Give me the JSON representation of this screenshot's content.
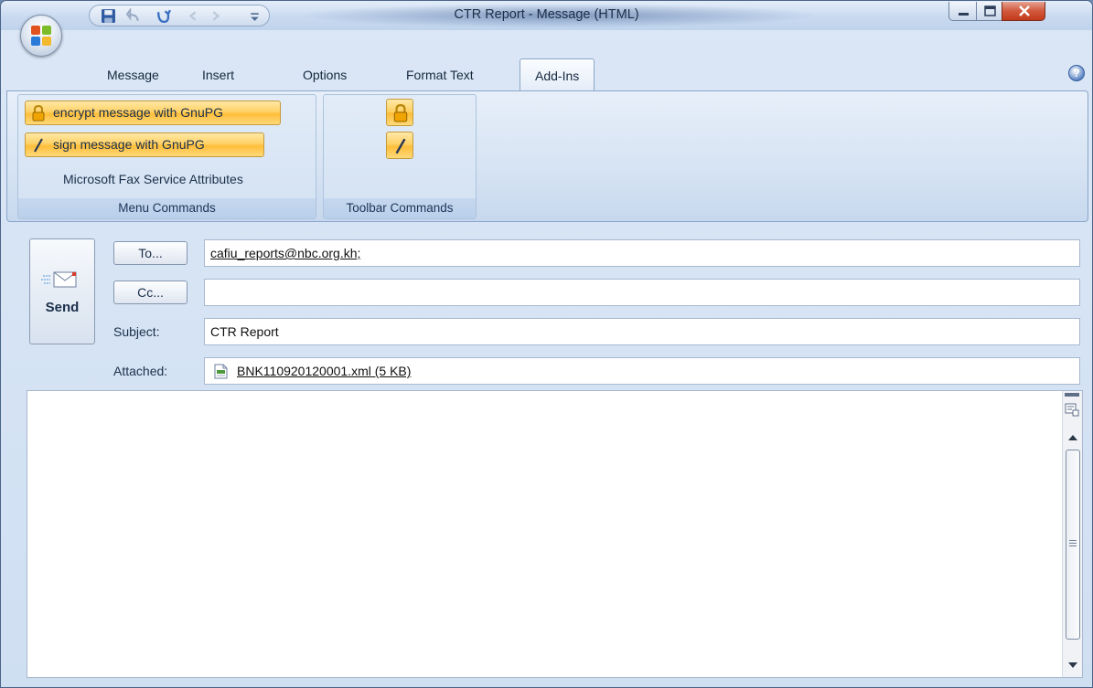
{
  "window": {
    "title": "CTR Report - Message (HTML)"
  },
  "ribbon_tabs": [
    "Message",
    "Insert",
    "Options",
    "Format Text",
    "Add-Ins"
  ],
  "active_tab": "Add-Ins",
  "ribbon": {
    "menu_commands": {
      "label": "Menu Commands",
      "encrypt_label": "encrypt message with GnuPG",
      "sign_label": "sign message with GnuPG",
      "fax_label": "Microsoft  Fax Service Attributes"
    },
    "toolbar_commands": {
      "label": "Toolbar Commands"
    }
  },
  "message": {
    "send_label": "Send",
    "to_button": "To...",
    "cc_button": "Cc...",
    "to_value": "cafiu_reports@nbc.org.kh;",
    "cc_value": "",
    "subject_label": "Subject:",
    "subject_value": "CTR Report",
    "attached_label": "Attached:",
    "attachment": "BNK110920120001.xml (5 KB)",
    "body": ""
  },
  "icons": {
    "office_button": "office-logo-icon",
    "save": "save-icon",
    "undo": "undo-icon",
    "redo": "redo-icon",
    "lock": "lock-icon",
    "pen": "pen-icon",
    "help": "help-icon",
    "send": "send-envelope-icon",
    "attachment": "xml-file-icon"
  },
  "colors": {
    "accent_orange": "#ffd166",
    "ribbon_blue": "#d6e3f3",
    "close_red": "#c23a1b"
  }
}
